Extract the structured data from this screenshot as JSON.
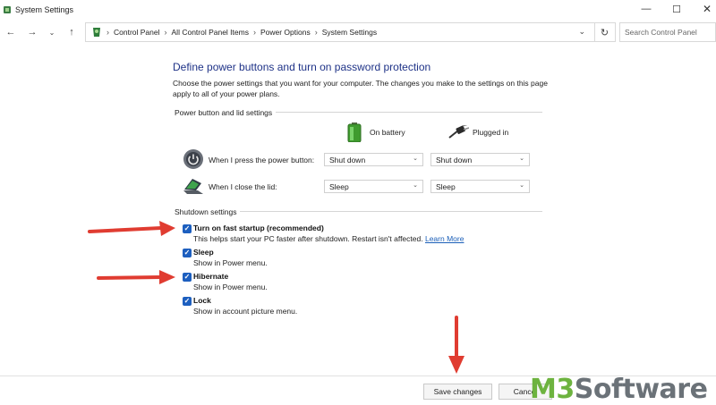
{
  "window": {
    "title": "System Settings"
  },
  "nav": {
    "breadcrumb": [
      "Control Panel",
      "All Control Panel Items",
      "Power Options",
      "System Settings"
    ],
    "search_placeholder": "Search Control Panel"
  },
  "page": {
    "title": "Define power buttons and turn on password protection",
    "description": "Choose the power settings that you want for your computer. The changes you make to the settings on this page apply to all of your power plans."
  },
  "power_section": {
    "header": "Power button and lid settings",
    "col_battery": "On battery",
    "col_plugged": "Plugged in",
    "rows": [
      {
        "label": "When I press the power button:",
        "battery": "Shut down",
        "plugged": "Shut down"
      },
      {
        "label": "When I close the lid:",
        "battery": "Sleep",
        "plugged": "Sleep"
      }
    ]
  },
  "shutdown_section": {
    "header": "Shutdown settings",
    "options": [
      {
        "label": "Turn on fast startup (recommended)",
        "sub": "This helps start your PC faster after shutdown. Restart isn't affected.",
        "link": "Learn More",
        "checked": true
      },
      {
        "label": "Sleep",
        "sub": "Show in Power menu.",
        "checked": true
      },
      {
        "label": "Hibernate",
        "sub": "Show in Power menu.",
        "checked": true
      },
      {
        "label": "Lock",
        "sub": "Show in account picture menu.",
        "checked": true
      }
    ]
  },
  "footer": {
    "save_label": "Save changes",
    "cancel_label": "Cancel"
  },
  "watermark": {
    "brand": "M3",
    "suffix": "Software"
  },
  "colors": {
    "title_blue": "#1e3287",
    "checkbox_blue": "#1d5fbf",
    "arrow_red": "#e03c31",
    "link_blue": "#1b5fb8"
  }
}
